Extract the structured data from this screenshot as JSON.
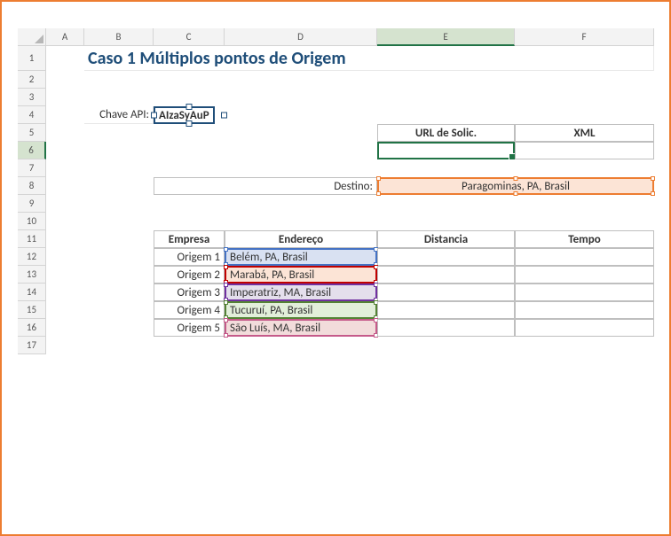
{
  "columns": [
    "A",
    "B",
    "C",
    "D",
    "E",
    "F"
  ],
  "rows": [
    "1",
    "2",
    "3",
    "4",
    "5",
    "6",
    "7",
    "8",
    "9",
    "10",
    "11",
    "12",
    "13",
    "14",
    "15",
    "16",
    "17"
  ],
  "title": "Caso 1 Múltiplos pontos de Origem",
  "chave_label": "Chave API:",
  "chave_value": "AIzaSyAuP",
  "url_header": "URL de Solic.",
  "xml_header": "XML",
  "destino_label": "Destino:",
  "destino_value": "Paragominas, PA, Brasil",
  "table_headers": {
    "empresa": "Empresa",
    "endereco": "Endereço",
    "distancia": "Distancia",
    "tempo": "Tempo"
  },
  "origens": [
    {
      "label": "Origem 1",
      "endereco": "Belém, PA, Brasil",
      "color": "c-blue"
    },
    {
      "label": "Origem 2",
      "endereco": "Marabá, PA, Brasil",
      "color": "c-red"
    },
    {
      "label": "Origem 3",
      "endereco": "Imperatriz, MA, Brasil",
      "color": "c-purple"
    },
    {
      "label": "Origem 4",
      "endereco": "Tucuruí, PA, Brasil",
      "color": "c-green"
    },
    {
      "label": "Origem 5",
      "endereco": "São Luís, MA, Brasil",
      "color": "c-pink"
    }
  ],
  "active_column": "E",
  "active_row": "6"
}
